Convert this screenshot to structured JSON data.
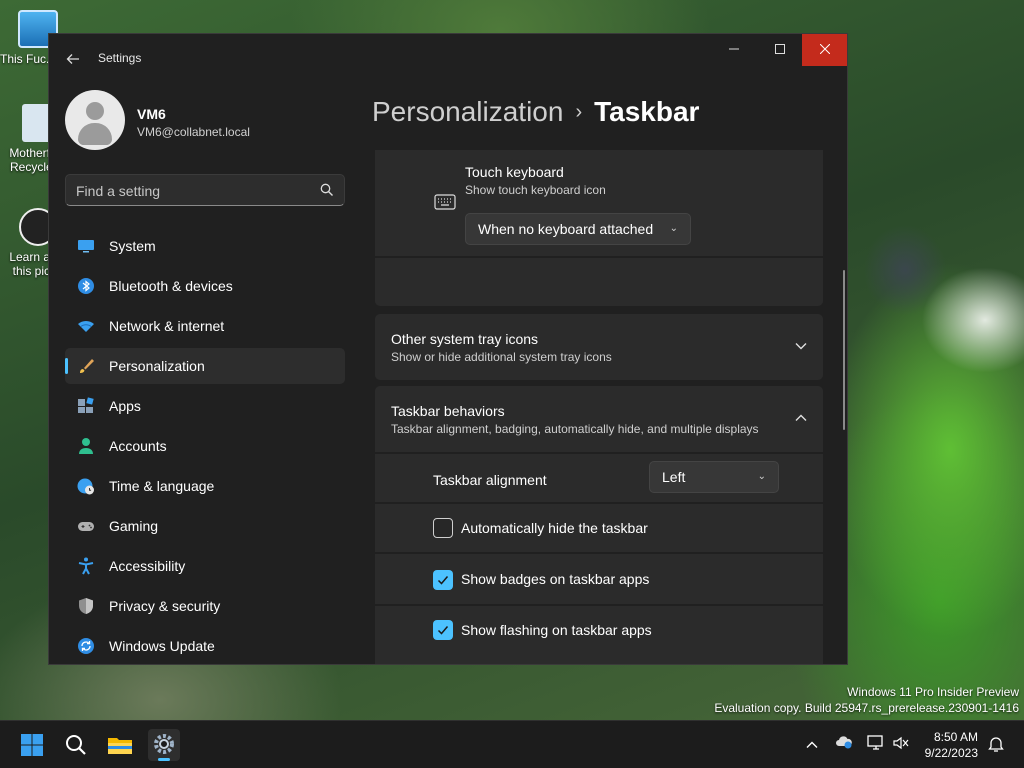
{
  "desktop": {
    "icons": [
      {
        "label": "This Fuc... PC"
      },
      {
        "label": "Motherfu... Recycle ..."
      },
      {
        "label": "Learn ab... this pict..."
      }
    ]
  },
  "window": {
    "app_title": "Settings",
    "back_icon": "arrow-left-icon",
    "controls": [
      "minimize",
      "maximize",
      "close"
    ]
  },
  "profile": {
    "name": "VM6",
    "email": "VM6@collabnet.local"
  },
  "search": {
    "placeholder": "Find a setting"
  },
  "sidebar": {
    "items": [
      {
        "label": "System",
        "icon": "monitor-icon",
        "active": false
      },
      {
        "label": "Bluetooth & devices",
        "icon": "bluetooth-icon",
        "active": false
      },
      {
        "label": "Network & internet",
        "icon": "wifi-icon",
        "active": false
      },
      {
        "label": "Personalization",
        "icon": "brush-icon",
        "active": true
      },
      {
        "label": "Apps",
        "icon": "apps-icon",
        "active": false
      },
      {
        "label": "Accounts",
        "icon": "person-icon",
        "active": false
      },
      {
        "label": "Time & language",
        "icon": "globe-clock-icon",
        "active": false
      },
      {
        "label": "Gaming",
        "icon": "gamepad-icon",
        "active": false
      },
      {
        "label": "Accessibility",
        "icon": "accessibility-icon",
        "active": false
      },
      {
        "label": "Privacy & security",
        "icon": "shield-icon",
        "active": false
      },
      {
        "label": "Windows Update",
        "icon": "update-icon",
        "active": false
      }
    ]
  },
  "breadcrumb": {
    "parent": "Personalization",
    "separator": "›",
    "current": "Taskbar"
  },
  "content": {
    "touch_keyboard": {
      "title": "Touch keyboard",
      "subtitle": "Show touch keyboard icon",
      "dropdown_value": "When no keyboard attached"
    },
    "other_tray": {
      "title": "Other system tray icons",
      "subtitle": "Show or hide additional system tray icons"
    },
    "behaviors": {
      "title": "Taskbar behaviors",
      "subtitle": "Taskbar alignment, badging, automatically hide, and multiple displays",
      "alignment_label": "Taskbar alignment",
      "alignment_value": "Left",
      "options": [
        {
          "label": "Automatically hide the taskbar",
          "checked": false
        },
        {
          "label": "Show badges on taskbar apps",
          "checked": true
        },
        {
          "label": "Show flashing on taskbar apps",
          "checked": true
        }
      ]
    }
  },
  "watermark": {
    "line1": "Windows 11 Pro Insider Preview",
    "line2": "Evaluation copy. Build 25947.rs_prerelease.230901-1416"
  },
  "taskbar": {
    "apps": [
      "start-icon",
      "search-icon",
      "file-explorer-icon",
      "settings-icon"
    ],
    "tray": [
      "chevron-up-icon",
      "onedrive-icon",
      "network-icon",
      "volume-muted-icon"
    ],
    "time": "8:50 AM",
    "date": "9/22/2023",
    "notification_icon": "bell-icon"
  },
  "colors": {
    "accent": "#4cc2ff",
    "window_bg": "#202020",
    "card_bg": "#2b2b2b",
    "close_red": "#c42b1c"
  }
}
